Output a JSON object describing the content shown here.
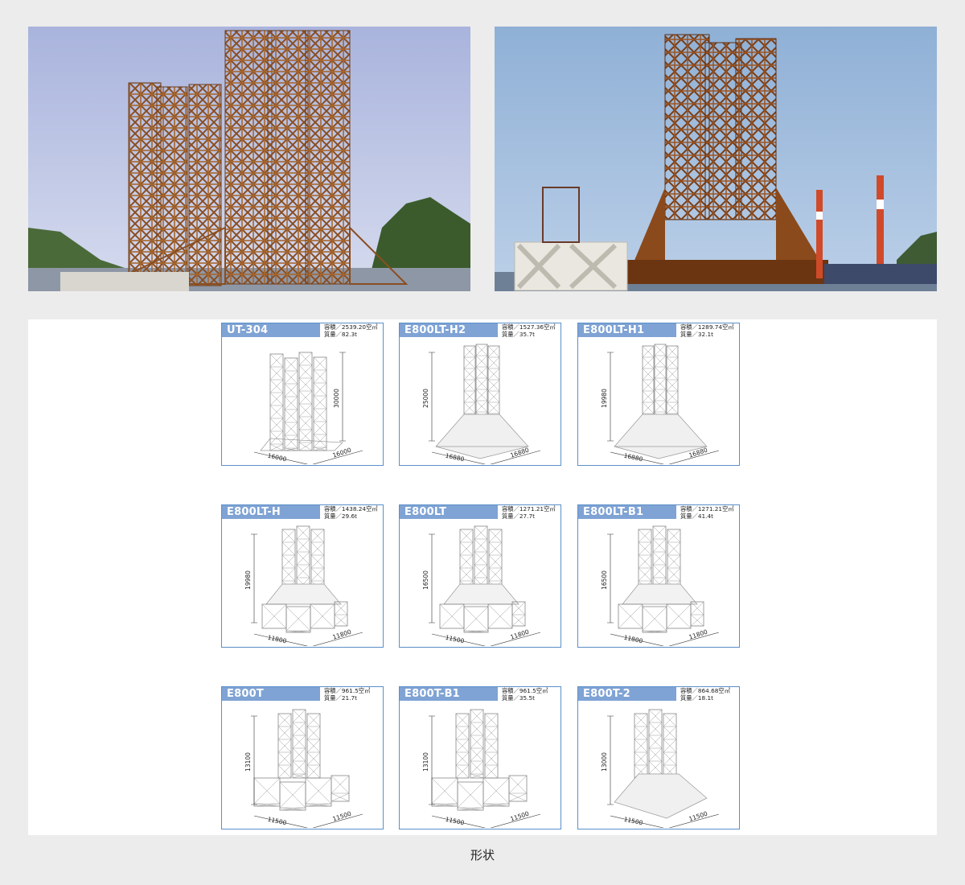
{
  "photos": {
    "left": {
      "scene": "steel lattice tower structures under construction at a harbor, forested hill behind"
    },
    "right": {
      "scene": "steel tower structure on a barge at a port, red-and-white chimneys in background"
    }
  },
  "models": [
    {
      "name": "UT-304",
      "volume": "容積／2539.20空㎥",
      "mass": "質量／82.3t",
      "height": "30000",
      "width": "16000",
      "depth": "16000",
      "kind": "ut"
    },
    {
      "name": "E800LT-H2",
      "volume": "容積／1527.36空㎥",
      "mass": "質量／35.7t",
      "height": "25000",
      "width": "16880",
      "depth": "16880",
      "kind": "lt"
    },
    {
      "name": "E800LT-H1",
      "volume": "容積／1289.74空㎥",
      "mass": "質量／32.1t",
      "height": "19980",
      "width": "16880",
      "depth": "16880",
      "kind": "lt"
    },
    {
      "name": "E800LT-H",
      "volume": "容積／1438.24空㎥",
      "mass": "質量／29.6t",
      "height": "19980",
      "width": "11800",
      "depth": "11800",
      "kind": "ltb"
    },
    {
      "name": "E800LT",
      "volume": "容積／1271.21空㎥",
      "mass": "質量／27.7t",
      "height": "16500",
      "width": "11500",
      "depth": "11800",
      "kind": "ltb"
    },
    {
      "name": "E800LT-B1",
      "volume": "容積／1271.21空㎥",
      "mass": "質量／41.4t",
      "height": "16500",
      "width": "11800",
      "depth": "11800",
      "kind": "ltb"
    },
    {
      "name": "E800T",
      "volume": "容積／961.5空㎥",
      "mass": "質量／21.7t",
      "height": "13100",
      "width": "11500",
      "depth": "11500",
      "kind": "t"
    },
    {
      "name": "E800T-B1",
      "volume": "容積／961.5空㎥",
      "mass": "質量／35.5t",
      "height": "13100",
      "width": "11500",
      "depth": "11500",
      "kind": "t"
    },
    {
      "name": "E800T-2",
      "volume": "容積／864.68空㎥",
      "mass": "質量／18.1t",
      "height": "13000",
      "width": "11500",
      "depth": "11500",
      "kind": "t2"
    }
  ],
  "caption": "形状",
  "colors": {
    "card_border": "#5b8fc9",
    "card_header": "#7fa3d4",
    "page_bg": "#ececec"
  }
}
